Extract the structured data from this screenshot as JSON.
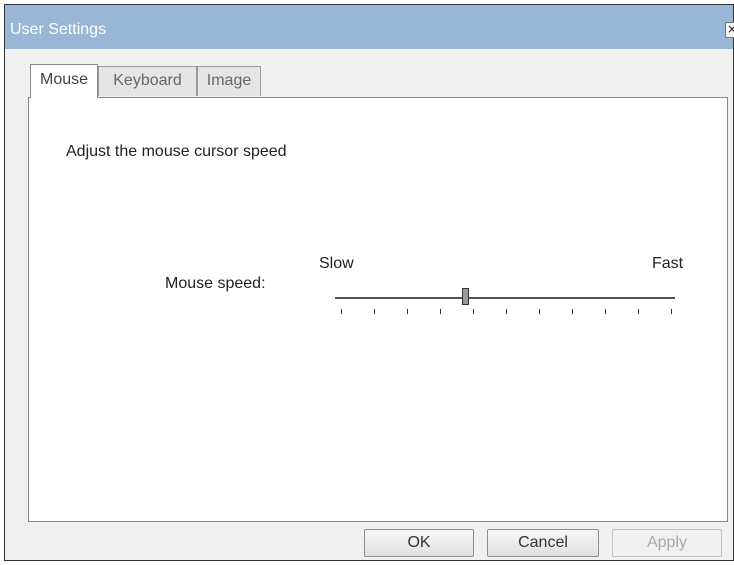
{
  "window": {
    "title": "User Settings",
    "close_icon_glyph": "×",
    "titlebar_color": "#9ab6d6"
  },
  "tabs": [
    {
      "label": "Mouse",
      "active": true
    },
    {
      "label": "Keyboard",
      "active": false
    },
    {
      "label": "Image",
      "active": false
    }
  ],
  "mouse_panel": {
    "instruction": "Adjust the mouse cursor speed",
    "speed_label": "Mouse speed:",
    "slider": {
      "min_label": "Slow",
      "max_label": "Fast",
      "tick_count": 11,
      "value_fraction": 0.375
    }
  },
  "buttons": {
    "ok": {
      "label": "OK",
      "enabled": true
    },
    "cancel": {
      "label": "Cancel",
      "enabled": true
    },
    "apply": {
      "label": "Apply",
      "enabled": false
    }
  }
}
